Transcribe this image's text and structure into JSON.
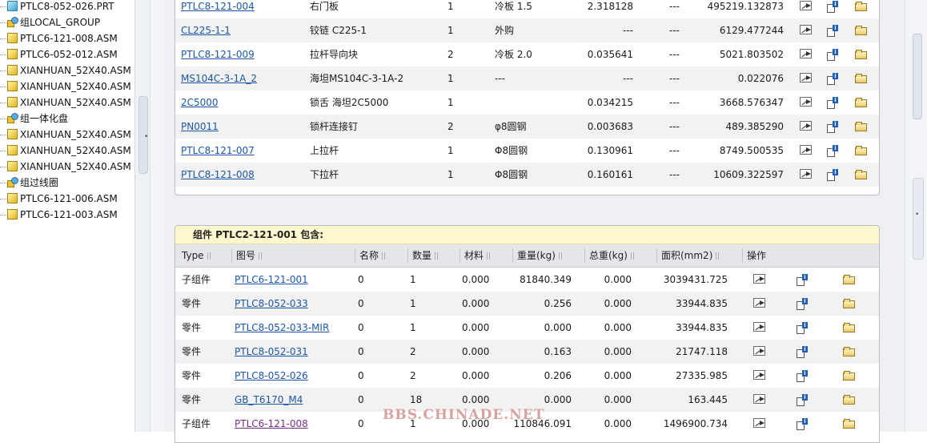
{
  "tree": {
    "items": [
      {
        "label": "PTLC8-052-026.PRT",
        "icon": "part-icon"
      },
      {
        "label": "组LOCAL_GROUP",
        "icon": "group-icon"
      },
      {
        "label": "PTLC6-121-008.ASM",
        "icon": "assembly-icon"
      },
      {
        "label": "PTLC6-052-012.ASM",
        "icon": "assembly-icon"
      },
      {
        "label": "XIANHUAN_52X40.ASM",
        "icon": "assembly-icon"
      },
      {
        "label": "XIANHUAN_52X40.ASM",
        "icon": "assembly-icon"
      },
      {
        "label": "XIANHUAN_52X40.ASM",
        "icon": "assembly-icon"
      },
      {
        "label": "组一体化盘",
        "icon": "group-icon"
      },
      {
        "label": "XIANHUAN_52X40.ASM",
        "icon": "assembly-icon"
      },
      {
        "label": "XIANHUAN_52X40.ASM",
        "icon": "assembly-icon"
      },
      {
        "label": "XIANHUAN_52X40.ASM",
        "icon": "assembly-icon"
      },
      {
        "label": "组过线圈",
        "icon": "group-icon"
      },
      {
        "label": "PTLC6-121-006.ASM",
        "icon": "assembly-icon"
      },
      {
        "label": "PTLC6-121-003.ASM",
        "icon": "assembly-icon"
      }
    ]
  },
  "upper_table": {
    "rows": [
      {
        "part": "PTLC8-121-004",
        "name": "右门板",
        "qty": "1",
        "material": "冷板  1.5",
        "weight": "2.318128",
        "total": "---",
        "area": "495219.132873"
      },
      {
        "part": "CL225-1-1",
        "name": "铰链  C225-1",
        "qty": "1",
        "material": "外购",
        "weight": "---",
        "total": "---",
        "area": "6129.477244"
      },
      {
        "part": "PTLC8-121-009",
        "name": "拉杆导向块",
        "qty": "2",
        "material": "冷板  2.0",
        "weight": "0.035641",
        "total": "---",
        "area": "5021.803502"
      },
      {
        "part": "MS104C-3-1A_2",
        "name": "海坦MS104C-3-1A-2",
        "qty": "1",
        "material": "---",
        "weight": "---",
        "total": "---",
        "area": "0.022076"
      },
      {
        "part": "2C5000",
        "name": "锁舌  海坦2C5000",
        "qty": "1",
        "material": "",
        "weight": "0.034215",
        "total": "---",
        "area": "3668.576347"
      },
      {
        "part": "PN0011",
        "name": "锁杆连接钉",
        "qty": "2",
        "material": "φ8圆钢",
        "weight": "0.003683",
        "total": "---",
        "area": "489.385290"
      },
      {
        "part": "PTLC8-121-007",
        "name": "上拉杆",
        "qty": "1",
        "material": "Φ8圆钢",
        "weight": "0.130961",
        "total": "---",
        "area": "8749.500535"
      },
      {
        "part": "PTLC8-121-008",
        "name": "下拉杆",
        "qty": "1",
        "material": "Φ8圆钢",
        "weight": "0.160161",
        "total": "---",
        "area": "10609.322597"
      }
    ]
  },
  "lower_panel": {
    "title": "组件  PTLC2-121-001 包含:",
    "headers": [
      "Type",
      "图号",
      "名称",
      "数量",
      "材料",
      "重量(kg)",
      "总重(kg)",
      "面积(mm2)",
      "操作"
    ],
    "rows": [
      {
        "type": "子组件",
        "part": "PTLC6-121-001",
        "name": "0",
        "qty": "1",
        "material": "0.000",
        "weight": "81840.349",
        "total": "0.000",
        "area": "3039431.725"
      },
      {
        "type": "零件",
        "part": "PTLC8-052-033",
        "name": "0",
        "qty": "1",
        "material": "0.000",
        "weight": "0.256",
        "total": "0.000",
        "area": "33944.835"
      },
      {
        "type": "零件",
        "part": "PTLC8-052-033-MIR",
        "name": "0",
        "qty": "1",
        "material": "0.000",
        "weight": "0.000",
        "total": "0.000",
        "area": "33944.835"
      },
      {
        "type": "零件",
        "part": "PTLC8-052-031",
        "name": "0",
        "qty": "2",
        "material": "0.000",
        "weight": "0.163",
        "total": "0.000",
        "area": "21747.118"
      },
      {
        "type": "零件",
        "part": "PTLC8-052-026",
        "name": "0",
        "qty": "2",
        "material": "0.000",
        "weight": "0.206",
        "total": "0.000",
        "area": "27335.985"
      },
      {
        "type": "零件",
        "part": "GB_T6170_M4",
        "name": "0",
        "qty": "18",
        "material": "0.000",
        "weight": "0.000",
        "total": "0.000",
        "area": "163.445"
      },
      {
        "type": "子组件",
        "part": "PTLC6-121-008",
        "name": "0",
        "qty": "1",
        "material": "0.000",
        "weight": "110846.091",
        "total": "0.000",
        "area": "1496900.734"
      }
    ]
  },
  "watermark": "BBS.CHINADE.NET"
}
